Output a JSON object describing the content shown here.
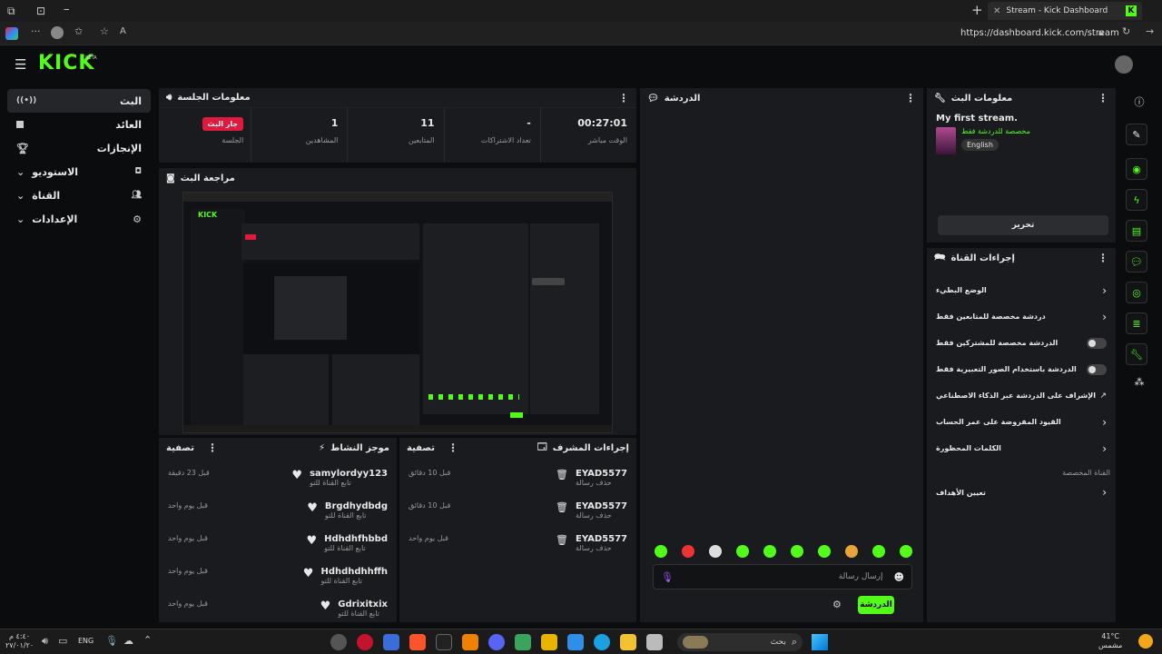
{
  "browser": {
    "tab_title": "Stream - Kick Dashboard",
    "url": "https://dashboard.kick.com/stream"
  },
  "topbar": {
    "logo": "KICK",
    "beta": "BETA"
  },
  "sidebar": {
    "items": [
      {
        "label": "البث"
      },
      {
        "label": "العائد"
      },
      {
        "label": "الإنجازات"
      },
      {
        "label": "الاستوديو"
      },
      {
        "label": "القناة"
      },
      {
        "label": "الإعدادات"
      }
    ]
  },
  "session": {
    "title": "معلومات الجلسة",
    "live_badge": "جار البث",
    "stats": [
      {
        "value": "00:27:01",
        "label": "الوقت مباشر"
      },
      {
        "value": "-",
        "label": "تعداد الاشتراكات"
      },
      {
        "value": "11",
        "label": "المتابعين"
      },
      {
        "value": "1",
        "label": "المشاهدين"
      },
      {
        "value": "",
        "label": "الجلسة"
      }
    ]
  },
  "preview": {
    "title": "مراجعة البث"
  },
  "activity": {
    "title": "موجز النشاط",
    "filter": "تصفية",
    "items": [
      {
        "name": "samylordyy123",
        "sub": "تابع القناة للتو",
        "time": "قبل 23 دقيقة"
      },
      {
        "name": "Brgdhydbdg",
        "sub": "تابع القناة للتو",
        "time": "قبل يوم واحد"
      },
      {
        "name": "Hdhdhfhbbd",
        "sub": "تابع القناة للتو",
        "time": "قبل يوم واحد"
      },
      {
        "name": "Hdhdhdhhffh",
        "sub": "تابع القناة للتو",
        "time": "قبل يوم واحد"
      },
      {
        "name": "Gdrixitxix",
        "sub": "تابع القناة للتو",
        "time": "قبل يوم واحد"
      }
    ]
  },
  "mod": {
    "title": "إجراءات المشرف",
    "filter": "تصفية",
    "items": [
      {
        "name": "EYAD5577",
        "sub": "حذف رسالة",
        "time": "قبل 10 دقائق"
      },
      {
        "name": "EYAD5577",
        "sub": "حذف رسالة",
        "time": "قبل 10 دقائق"
      },
      {
        "name": "EYAD5577",
        "sub": "حذف رسالة",
        "time": "قبل يوم واحد"
      }
    ]
  },
  "chat": {
    "title": "الدردشة",
    "placeholder": "إرسال رسالة",
    "send": "الدردشة"
  },
  "stream_info": {
    "title": "معلومات البث",
    "stream_title": "My first stream.",
    "category": "مخصصة للدردشة فقط",
    "language": "English",
    "edit_button": "تحرير"
  },
  "channel_actions": {
    "title": "إجراءات القناة",
    "items": [
      {
        "label": "الوضع البطيء",
        "control": "arrow"
      },
      {
        "label": "دردشة مخصصة للمتابعين فقط",
        "control": "arrow"
      },
      {
        "label": "الدردشة مخصصة للمشتركين فقط",
        "control": "toggle"
      },
      {
        "label": "الدردشة باستخدام الصور التعبيرية فقط",
        "control": "toggle"
      },
      {
        "label": "الإشراف على الدردشة عبر الذكاء الاصطناعي",
        "control": "external"
      },
      {
        "label": "القيود المفروضة على عمر الحساب",
        "control": "arrow"
      },
      {
        "label": "الكلمات المحظورة",
        "control": "arrow"
      }
    ],
    "section_label": "القناة المخصصة",
    "goals": "تعيين الأهداف"
  },
  "taskbar": {
    "search": "بحث",
    "lang": "ENG",
    "time": "٤:٤٠ م",
    "date": "٢٧/٠١/٢٠",
    "temp": "41°C",
    "weather": "مشمس"
  }
}
